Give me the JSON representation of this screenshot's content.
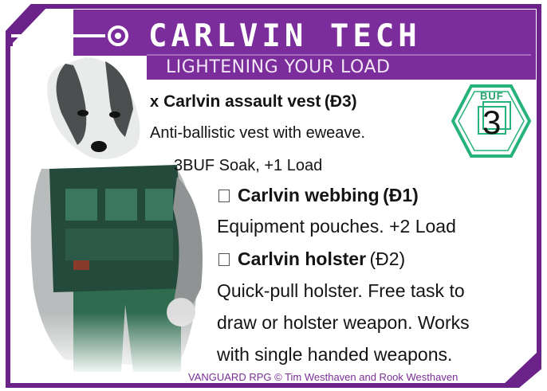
{
  "header": {
    "title": "CARLVIN TECH",
    "subtitle": "LIGHTENING YOUR LOAD"
  },
  "badge": {
    "label": "BUF",
    "value": "3"
  },
  "items": [
    {
      "check_mark": "x",
      "name": "Carlvin assault vest",
      "cost": "(Đ3)",
      "description": "Anti-ballistic vest with eweave.",
      "stats": "3BUF Soak, +1 Load"
    },
    {
      "name": "Carlvin webbing",
      "cost": "(Đ1)",
      "description": "Equipment pouches. +2 Load"
    },
    {
      "name": "Carlvin holster",
      "cost": "(Đ2)",
      "description_lines": [
        "Quick-pull holster. Free task to",
        "draw or holster weapon. Works",
        "with single handed weapons."
      ]
    }
  ],
  "footer": "VANGUARD RPG © Tim Westhaven and Rook Westhaven",
  "colors": {
    "frame": "#6b2389",
    "header_fill": "#7a2d9b",
    "badge": "#27b27a",
    "footer_text": "#7b2f97"
  },
  "icons": [
    "circuit-node-icon",
    "hexagon-badge-icon",
    "checkbox-icon"
  ]
}
